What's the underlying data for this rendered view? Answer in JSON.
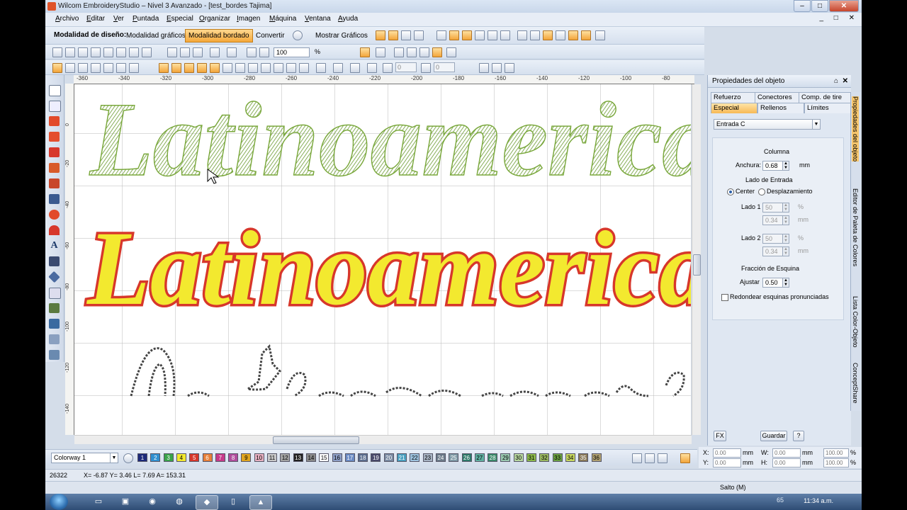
{
  "window": {
    "title": "Wilcom EmbroideryStudio – Nivel 3 Avanzado - [test_bordes    Tajima]",
    "controls": [
      "–",
      "□",
      "✕"
    ],
    "mdi_controls": "_ □ ✕"
  },
  "menu": [
    {
      "acc": "A",
      "rest": "rchivo"
    },
    {
      "acc": "E",
      "rest": "ditar"
    },
    {
      "acc": "V",
      "rest": "er"
    },
    {
      "acc": "P",
      "rest": "untada"
    },
    {
      "acc": "E",
      "rest": "special"
    },
    {
      "acc": "O",
      "rest": "rganizar"
    },
    {
      "acc": "I",
      "rest": "magen"
    },
    {
      "acc": "M",
      "rest": "áquina"
    },
    {
      "acc": "V",
      "rest": "entana"
    },
    {
      "acc": "A",
      "rest": "yuda"
    }
  ],
  "toolbar": {
    "mode_label": "Modalidad de diseño:",
    "mode_graphics": "Modalidad gráficos",
    "mode_embroidery": "Modalidad bordado",
    "convert": "Convertir",
    "show_graphics": "Mostrar Gráficos",
    "zoom_value": "100",
    "zoom_unit": "%",
    "angle_1": "0",
    "angle_2": "0"
  },
  "ruler": {
    "h_ticks": [
      "-360",
      "-340",
      "-320",
      "-300",
      "-280",
      "-260",
      "-240",
      "-220",
      "-200",
      "-180",
      "-160",
      "-140",
      "-120",
      "-100",
      "-80"
    ],
    "v_ticks": [
      "0",
      "-20",
      "-40",
      "-60",
      "-80",
      "-100",
      "-120",
      "-140"
    ]
  },
  "canvas": {
    "text_row_1": "Latinoamerica",
    "text_row_2": "Latinoamerica",
    "colors": {
      "green": "#8bb84a",
      "yellow": "#f3e92f",
      "red": "#d7372b",
      "outline": "#444444"
    }
  },
  "panel": {
    "title": "Propiedades del objeto",
    "tabs_top": [
      "Refuerzo",
      "Conectores",
      "Comp. de tire"
    ],
    "tabs_bottom": [
      "Especial",
      "Rellenos",
      "Límites"
    ],
    "stitch_type": "Entrada C",
    "column_header": "Columna",
    "width_label": "Anchura:",
    "width_value": "0.68",
    "width_unit": "mm",
    "entry_side_header": "Lado de Entrada",
    "radio_center": "Center",
    "radio_offset": "Desplazamiento",
    "side1_label": "Lado 1",
    "side1_pct": "50",
    "side1_mm": "0.34",
    "side2_label": "Lado 2",
    "side2_pct": "50",
    "side2_mm": "0.34",
    "pct_unit": "%",
    "mm_unit": "mm",
    "corner_header": "Fracción de Esquina",
    "adjust_label": "Ajustar",
    "adjust_value": "0.50",
    "round_corners": "Redondear esquinas pronunciadas",
    "btn_fx": "FX",
    "btn_save": "Guardar",
    "btn_help": "?",
    "pin": "⌂",
    "close": "✕"
  },
  "side_tabs": [
    "Propiedades del objeto",
    "Editor de Paleta de Colores",
    "Lista Color-Objeto",
    "ConceptShare"
  ],
  "palette": {
    "colorway": "Colorway 1",
    "swatches": [
      {
        "n": "1",
        "c": "#1d2a7a",
        "t": "#ffffff"
      },
      {
        "n": "2",
        "c": "#2f8fd0",
        "t": "#ffffff"
      },
      {
        "n": "3",
        "c": "#3aa34a",
        "t": "#ffffff"
      },
      {
        "n": "4",
        "c": "#f3e92f",
        "t": "#000000"
      },
      {
        "n": "5",
        "c": "#d7372b",
        "t": "#ffffff"
      },
      {
        "n": "6",
        "c": "#e7803a",
        "t": "#ffffff"
      },
      {
        "n": "7",
        "c": "#c73a8a",
        "t": "#ffffff"
      },
      {
        "n": "8",
        "c": "#b04d9c",
        "t": "#ffffff"
      },
      {
        "n": "9",
        "c": "#e0a520",
        "t": "#000000"
      },
      {
        "n": "10",
        "c": "#e7b0c0",
        "t": "#000000"
      },
      {
        "n": "11",
        "c": "#c9c9c9",
        "t": "#000000"
      },
      {
        "n": "12",
        "c": "#a3a3a3",
        "t": "#000000"
      },
      {
        "n": "13",
        "c": "#222222",
        "t": "#ffffff"
      },
      {
        "n": "14",
        "c": "#8a8a8a",
        "t": "#000000"
      },
      {
        "n": "15",
        "c": "#ffffff",
        "t": "#000000"
      },
      {
        "n": "16",
        "c": "#8ea0c7",
        "t": "#000000"
      },
      {
        "n": "17",
        "c": "#6b8bc4",
        "t": "#ffffff"
      },
      {
        "n": "18",
        "c": "#5d6f8f",
        "t": "#ffffff"
      },
      {
        "n": "19",
        "c": "#4a4a6a",
        "t": "#ffffff"
      },
      {
        "n": "20",
        "c": "#7b8ba3",
        "t": "#ffffff"
      },
      {
        "n": "21",
        "c": "#4aa0c0",
        "t": "#ffffff"
      },
      {
        "n": "22",
        "c": "#9fc4e0",
        "t": "#000000"
      },
      {
        "n": "23",
        "c": "#a8b4c4",
        "t": "#000000"
      },
      {
        "n": "24",
        "c": "#6c7b8a",
        "t": "#ffffff"
      },
      {
        "n": "25",
        "c": "#7f9aa6",
        "t": "#ffffff"
      },
      {
        "n": "26",
        "c": "#2e7a6a",
        "t": "#ffffff"
      },
      {
        "n": "27",
        "c": "#5fb0a0",
        "t": "#000000"
      },
      {
        "n": "28",
        "c": "#3a8a6a",
        "t": "#ffffff"
      },
      {
        "n": "29",
        "c": "#9ac8b0",
        "t": "#000000"
      },
      {
        "n": "30",
        "c": "#b8d8a0",
        "t": "#000000"
      },
      {
        "n": "31",
        "c": "#8bb84a",
        "t": "#000000"
      },
      {
        "n": "32",
        "c": "#9ab860",
        "t": "#000000"
      },
      {
        "n": "33",
        "c": "#6aa040",
        "t": "#000000"
      },
      {
        "n": "34",
        "c": "#c8d860",
        "t": "#000000"
      },
      {
        "n": "35",
        "c": "#8a7a5a",
        "t": "#ffffff"
      },
      {
        "n": "36",
        "c": "#b0a070",
        "t": "#000000"
      }
    ]
  },
  "coords": {
    "x_label": "X:",
    "x": "0.00",
    "y_label": "Y:",
    "y": "0.00",
    "w_label": "W:",
    "w": "0.00",
    "h_label": "H:",
    "h": "0.00",
    "unit": "mm",
    "pct_w": "100.00",
    "pct_h": "100.00",
    "pct": "%"
  },
  "status": {
    "stitch_count": "26322",
    "cursor_info": "X=  -6.87 Y=   3.46 L=   7.69 A= 153.31",
    "mode": "Salto (M)"
  },
  "taskbar": {
    "clock": "11:34 a.m.",
    "tray": "65"
  }
}
